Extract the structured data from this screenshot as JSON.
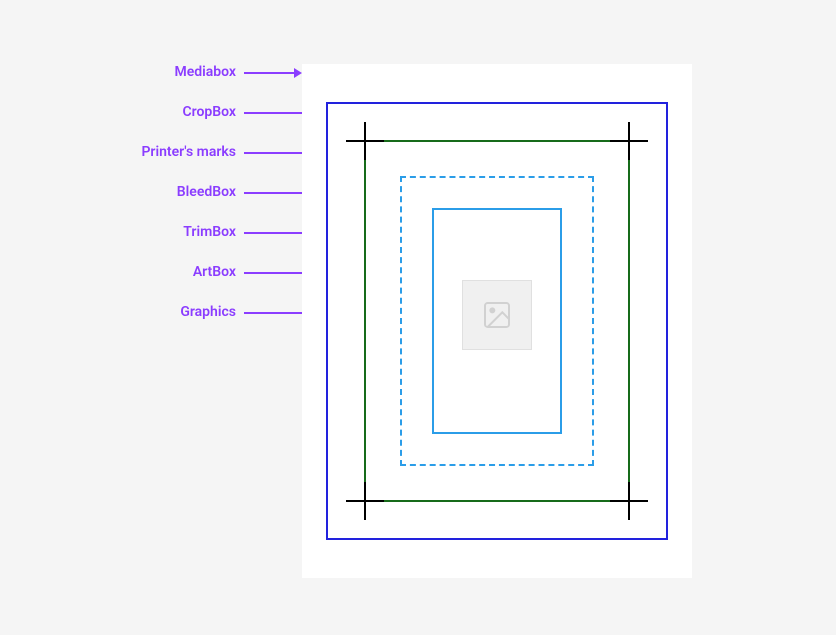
{
  "labels": {
    "mediabox": "Mediabox",
    "cropbox": "CropBox",
    "printers_marks": "Printer's marks",
    "bleedbox": "BleedBox",
    "trimbox": "TrimBox",
    "artbox": "ArtBox",
    "graphics": "Graphics"
  },
  "colors": {
    "label": "#8b3dff",
    "cropbox": "#2222dd",
    "printers_marks": "#176b1a",
    "bleedbox": "#2b9de8",
    "trimbox": "#2b9de8",
    "paper": "#ffffff",
    "background": "#f5f5f5"
  }
}
